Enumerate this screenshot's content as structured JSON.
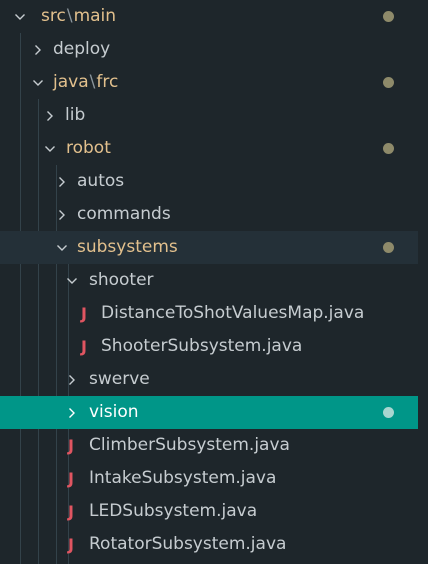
{
  "colors": {
    "background": "#1e262b",
    "selection": "#009688",
    "modified_text": "#e2c08d",
    "java_icon": "#e05561",
    "modified_dot": "#8e8a6a"
  },
  "tree": {
    "src_main": {
      "part1": "src",
      "sep": "\\",
      "part2": "main",
      "icon": "chevron-down-icon"
    },
    "deploy": {
      "label": "deploy",
      "icon": "chevron-right-icon"
    },
    "java_frc": {
      "part1": "java",
      "sep": "\\",
      "part2": "frc",
      "icon": "chevron-down-icon"
    },
    "lib": {
      "label": "lib",
      "icon": "chevron-right-icon"
    },
    "robot": {
      "label": "robot",
      "icon": "chevron-down-icon"
    },
    "autos": {
      "label": "autos",
      "icon": "chevron-right-icon"
    },
    "commands": {
      "label": "commands",
      "icon": "chevron-right-icon"
    },
    "subsystems": {
      "label": "subsystems",
      "icon": "chevron-down-icon"
    },
    "shooter": {
      "label": "shooter",
      "icon": "chevron-down-icon"
    },
    "distance_file": {
      "label": "DistanceToShotValuesMap.java",
      "icon": "java-icon",
      "glyph": "J"
    },
    "shooter_file": {
      "label": "ShooterSubsystem.java",
      "icon": "java-icon",
      "glyph": "J"
    },
    "swerve": {
      "label": "swerve",
      "icon": "chevron-right-icon"
    },
    "vision": {
      "label": "vision",
      "icon": "chevron-right-icon"
    },
    "climber_file": {
      "label": "ClimberSubsystem.java",
      "icon": "java-icon",
      "glyph": "J"
    },
    "intake_file": {
      "label": "IntakeSubsystem.java",
      "icon": "java-icon",
      "glyph": "J"
    },
    "led_file": {
      "label": "LEDSubsystem.java",
      "icon": "java-icon",
      "glyph": "J"
    },
    "rotator_file": {
      "label": "RotatorSubsystem.java",
      "icon": "java-icon",
      "glyph": "J"
    }
  }
}
